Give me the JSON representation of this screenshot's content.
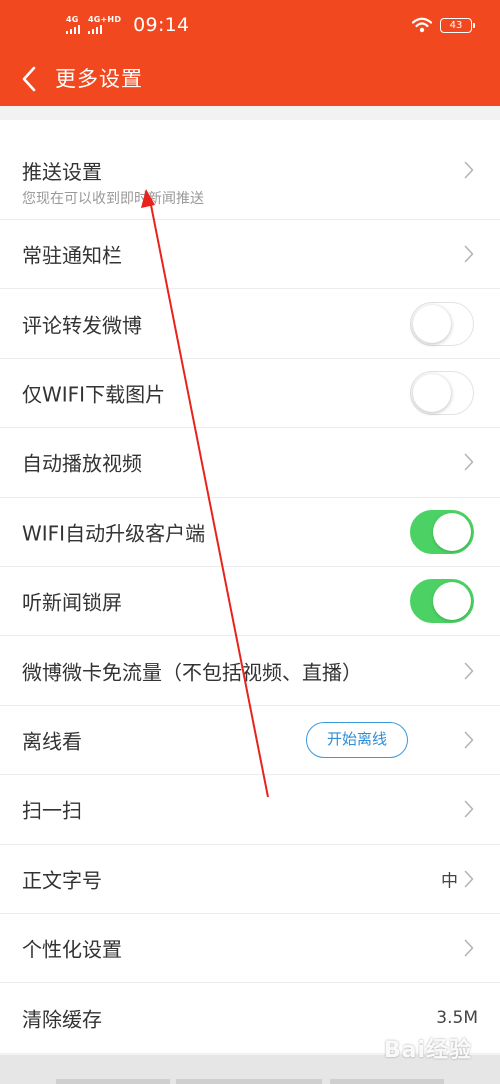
{
  "status_bar": {
    "network_1": "4G",
    "network_2": "4G+HD",
    "time": "09:14",
    "battery": "43"
  },
  "header": {
    "title": "更多设置"
  },
  "settings": {
    "push": {
      "label": "推送设置",
      "subtitle": "您现在可以收到即时新闻推送"
    },
    "notification_bar": {
      "label": "常驻通知栏"
    },
    "comment_repost_weibo": {
      "label": "评论转发微博",
      "enabled": false
    },
    "wifi_only_images": {
      "label": "仅WIFI下载图片",
      "enabled": false
    },
    "autoplay_video": {
      "label": "自动播放视频"
    },
    "wifi_auto_upgrade": {
      "label": "WIFI自动升级客户端",
      "enabled": true
    },
    "listen_news_lock_screen": {
      "label": "听新闻锁屏",
      "enabled": true
    },
    "weibo_card_free_data": {
      "label": "微博微卡免流量（不包括视频、直播）"
    },
    "offline_reading": {
      "label": "离线看",
      "button": "开始离线"
    },
    "scan": {
      "label": "扫一扫"
    },
    "font_size": {
      "label": "正文字号",
      "value": "中"
    },
    "personalization": {
      "label": "个性化设置"
    },
    "clear_cache": {
      "label": "清除缓存",
      "value": "3.5M"
    }
  },
  "watermark": "Bai经验",
  "colors": {
    "brand": "#f2481f",
    "toggle_on": "#4cd264",
    "button_blue": "#2f8ed4",
    "annotation": "#e8231b"
  },
  "icons": {
    "back": "back-chevron-icon",
    "chevron": "chevron-right-icon",
    "wifi": "wifi-icon",
    "battery": "battery-icon",
    "signal": "signal-bars-icon"
  }
}
